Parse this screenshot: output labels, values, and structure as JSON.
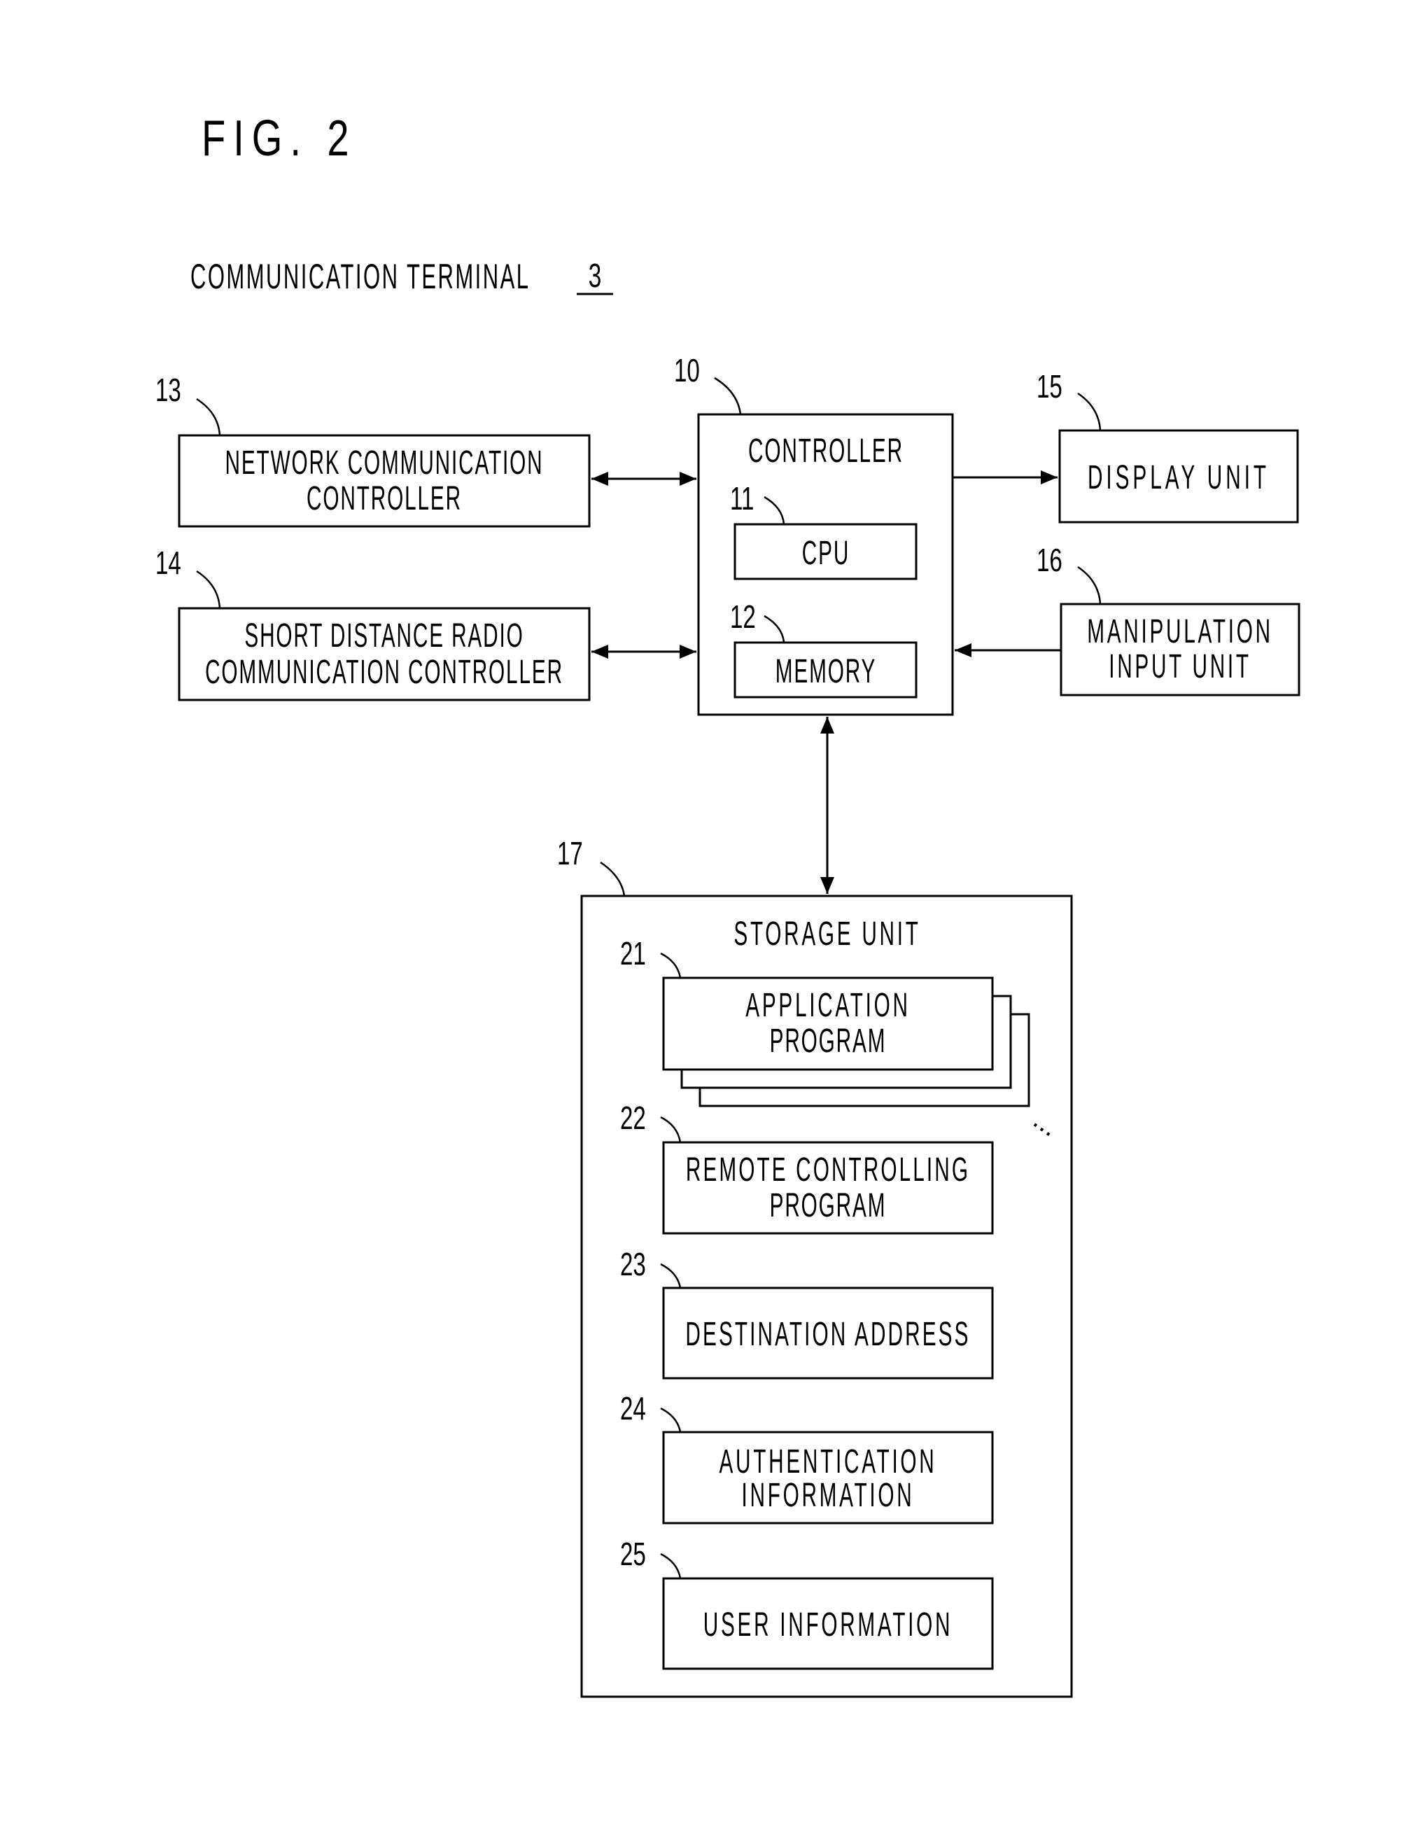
{
  "figure": {
    "title": "FIG. 2",
    "caption": "COMMUNICATION TERMINAL",
    "caption_ref": "3"
  },
  "blocks": {
    "controller": {
      "ref": "10",
      "lines": [
        "CONTROLLER"
      ]
    },
    "cpu": {
      "ref": "11",
      "lines": [
        "CPU"
      ]
    },
    "memory": {
      "ref": "12",
      "lines": [
        "MEMORY"
      ]
    },
    "network_comm": {
      "ref": "13",
      "lines": [
        "NETWORK COMMUNICATION",
        "CONTROLLER"
      ]
    },
    "short_radio": {
      "ref": "14",
      "lines": [
        "SHORT DISTANCE RADIO",
        "COMMUNICATION CONTROLLER"
      ]
    },
    "display": {
      "ref": "15",
      "lines": [
        "DISPLAY UNIT"
      ]
    },
    "manipulation": {
      "ref": "16",
      "lines": [
        "MANIPULATION",
        "INPUT UNIT"
      ]
    },
    "storage": {
      "ref": "17",
      "lines": [
        "STORAGE UNIT"
      ]
    },
    "app_program": {
      "ref": "21",
      "lines": [
        "APPLICATION",
        "PROGRAM"
      ]
    },
    "remote_program": {
      "ref": "22",
      "lines": [
        "REMOTE CONTROLLING",
        "PROGRAM"
      ]
    },
    "destination": {
      "ref": "23",
      "lines": [
        "DESTINATION ADDRESS"
      ]
    },
    "authentication": {
      "ref": "24",
      "lines": [
        "AUTHENTICATION",
        "INFORMATION"
      ]
    },
    "user_info": {
      "ref": "25",
      "lines": [
        "USER INFORMATION"
      ]
    }
  },
  "connections": [
    {
      "from": "network_comm",
      "to": "controller",
      "direction": "bidirectional"
    },
    {
      "from": "short_radio",
      "to": "controller",
      "direction": "bidirectional"
    },
    {
      "from": "controller",
      "to": "display",
      "direction": "forward"
    },
    {
      "from": "manipulation",
      "to": "controller",
      "direction": "forward"
    },
    {
      "from": "controller",
      "to": "storage",
      "direction": "bidirectional"
    }
  ],
  "ellipsis": "..."
}
